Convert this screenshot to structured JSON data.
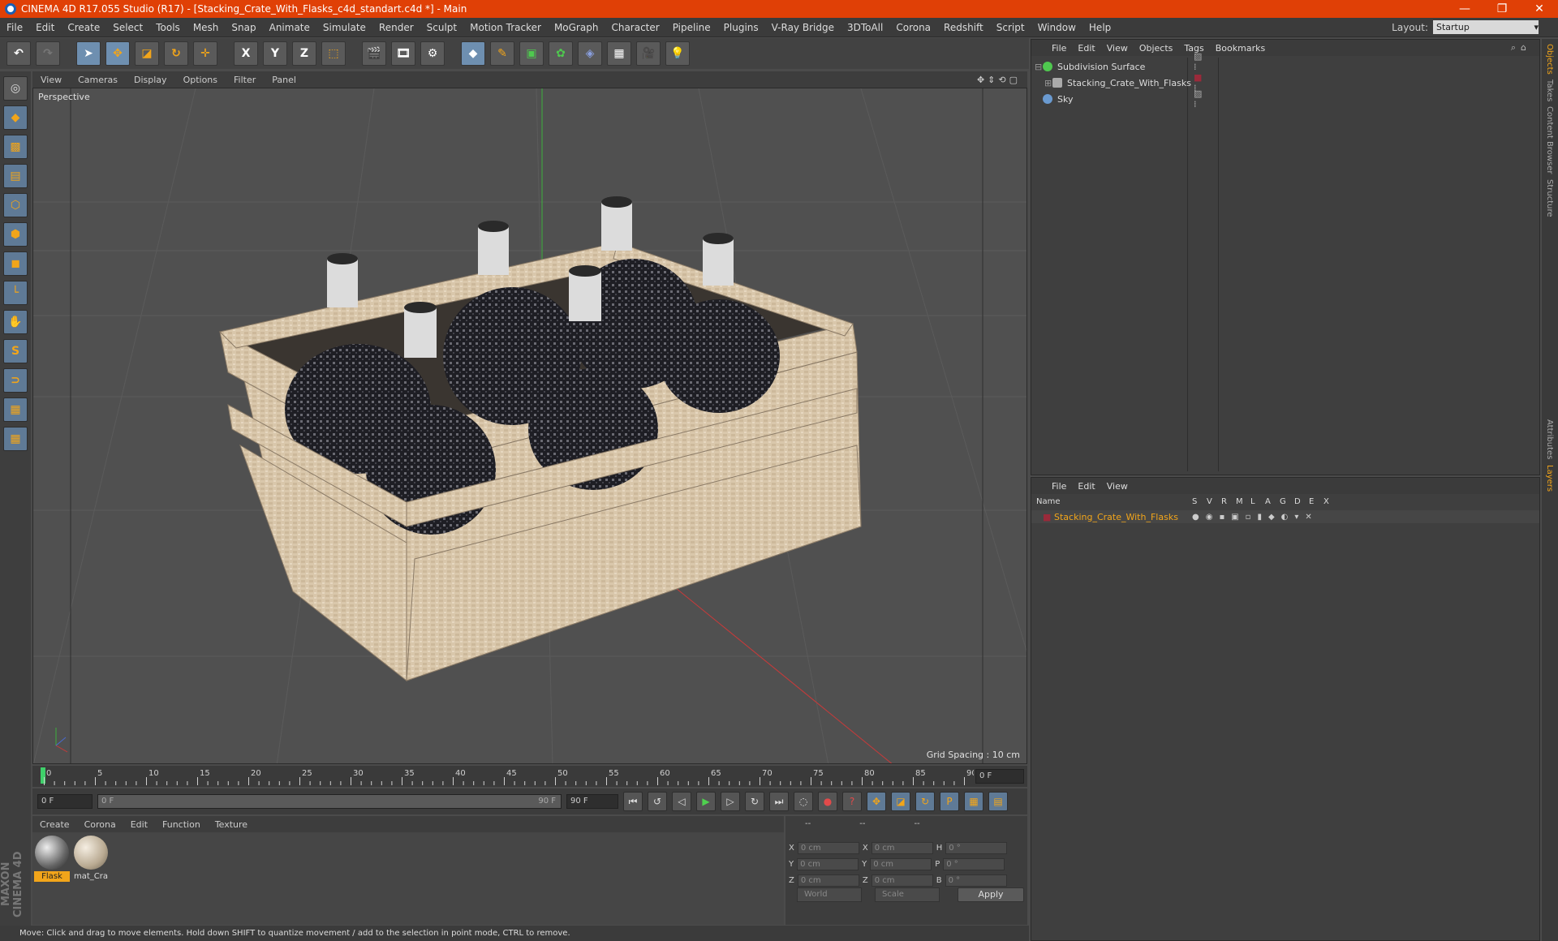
{
  "window": {
    "title": "CINEMA 4D R17.055 Studio (R17) - [Stacking_Crate_With_Flasks_c4d_standart.c4d *] - Main",
    "controls": [
      "—",
      "❐",
      "✕"
    ]
  },
  "menubar": {
    "items": [
      "File",
      "Edit",
      "Create",
      "Select",
      "Tools",
      "Mesh",
      "Snap",
      "Animate",
      "Simulate",
      "Render",
      "Sculpt",
      "Motion Tracker",
      "MoGraph",
      "Character",
      "Pipeline",
      "Plugins",
      "V-Ray Bridge",
      "3DToAll",
      "Corona",
      "Redshift",
      "Script",
      "Window",
      "Help"
    ],
    "layout_label": "Layout:",
    "layout_value": "Startup"
  },
  "toolbar": {
    "axis_x": "X",
    "axis_y": "Y",
    "axis_z": "Z"
  },
  "viewport": {
    "menu": [
      "View",
      "Cameras",
      "Display",
      "Options",
      "Filter",
      "Panel"
    ],
    "label": "Perspective",
    "grid_spacing": "Grid Spacing : 10 cm"
  },
  "timeline": {
    "ticks": [
      "0",
      "5",
      "10",
      "15",
      "20",
      "25",
      "30",
      "35",
      "40",
      "45",
      "50",
      "55",
      "60",
      "65",
      "70",
      "75",
      "80",
      "85",
      "90"
    ],
    "current_frame": "0 F",
    "start": "0 F",
    "range_start": "0 F",
    "range_end": "90 F",
    "end": "90 F"
  },
  "materials": {
    "menu": [
      "Create",
      "Corona",
      "Edit",
      "Function",
      "Texture"
    ],
    "items": [
      {
        "name": "Flask",
        "color": "#8a8a8a"
      },
      {
        "name": "mat_Cra",
        "color": "#cfc2ad"
      }
    ]
  },
  "coords": {
    "header": [
      "--",
      "--",
      "--"
    ],
    "rows": [
      {
        "a": "X",
        "v1": "0 cm",
        "b": "X",
        "v2": "0 cm",
        "c": "H",
        "v3": "0 °"
      },
      {
        "a": "Y",
        "v1": "0 cm",
        "b": "Y",
        "v2": "0 cm",
        "c": "P",
        "v3": "0 °"
      },
      {
        "a": "Z",
        "v1": "0 cm",
        "b": "Z",
        "v2": "0 cm",
        "c": "B",
        "v3": "0 °"
      }
    ],
    "mode": "World",
    "mode2": "Scale",
    "apply": "Apply"
  },
  "status": "Move: Click and drag to move elements. Hold down SHIFT to quantize movement / add to the selection in point mode, CTRL to remove.",
  "objects": {
    "menu": [
      "File",
      "Edit",
      "View",
      "Objects",
      "Tags",
      "Bookmarks"
    ],
    "rows": [
      {
        "name": "Subdivision Surface",
        "color": "#4fc84f"
      },
      {
        "name": "Stacking_Crate_With_Flasks",
        "color": "#aaaaaa"
      },
      {
        "name": "Sky",
        "color": "#6a9ad0"
      }
    ]
  },
  "layers": {
    "menu": [
      "File",
      "Edit",
      "View"
    ],
    "head_name": "Name",
    "head_cols": [
      "S",
      "V",
      "R",
      "M",
      "L",
      "A",
      "G",
      "D",
      "E",
      "X"
    ],
    "row_name": "Stacking_Crate_With_Flasks",
    "row_color": "#9a2a3a"
  },
  "right_tabs": [
    "Objects",
    "Takes",
    "Content Browser",
    "Structure",
    "Attributes",
    "Layers"
  ],
  "colors": {
    "accent": "#e04006",
    "highlight": "#f2a51a",
    "selected_text": "#f2a51a"
  }
}
